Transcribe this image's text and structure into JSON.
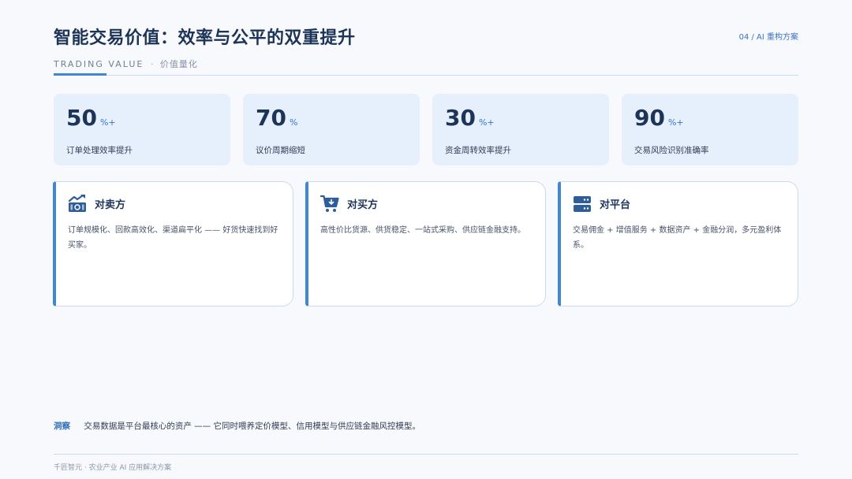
{
  "header": {
    "title": "智能交易价值：效率与公平的双重提升",
    "page_label": "04 / AI 重构方案",
    "subtitle_en": "TRADING VALUE",
    "subtitle_sep": "·",
    "subtitle_cn": "价值量化"
  },
  "stats": [
    {
      "value": "50",
      "unit": "%+",
      "label": "订单处理效率提升"
    },
    {
      "value": "70",
      "unit": "%",
      "label": "议价周期缩短"
    },
    {
      "value": "30",
      "unit": "%+",
      "label": "资金周转效率提升"
    },
    {
      "value": "90",
      "unit": "%+",
      "label": "交易风险识别准确率"
    }
  ],
  "cards": [
    {
      "icon": "growth-chart-icon",
      "title": "对卖方",
      "body": "订单规模化、回款高效化、渠道扁平化 —— 好货快速找到好买家。"
    },
    {
      "icon": "shopping-cart-icon",
      "title": "对买方",
      "body": "高性价比货源、供货稳定、一站式采购、供应链金融支持。"
    },
    {
      "icon": "server-icon",
      "title": "对平台",
      "body": "交易佣金 + 增值服务 + 数据资产 + 金融分润，多元盈利体系。"
    }
  ],
  "insight": {
    "tag": "洞察",
    "text": "交易数据是平台最核心的资产 —— 它同时喂养定价模型、信用模型与供应链金融风控模型。"
  },
  "footer": {
    "text": "千匠智元 · 农业产业 AI 应用解决方案"
  },
  "colors": {
    "accent": "#3f86d3",
    "title": "#1d3458",
    "stat_bg": "#e6f0fc"
  }
}
